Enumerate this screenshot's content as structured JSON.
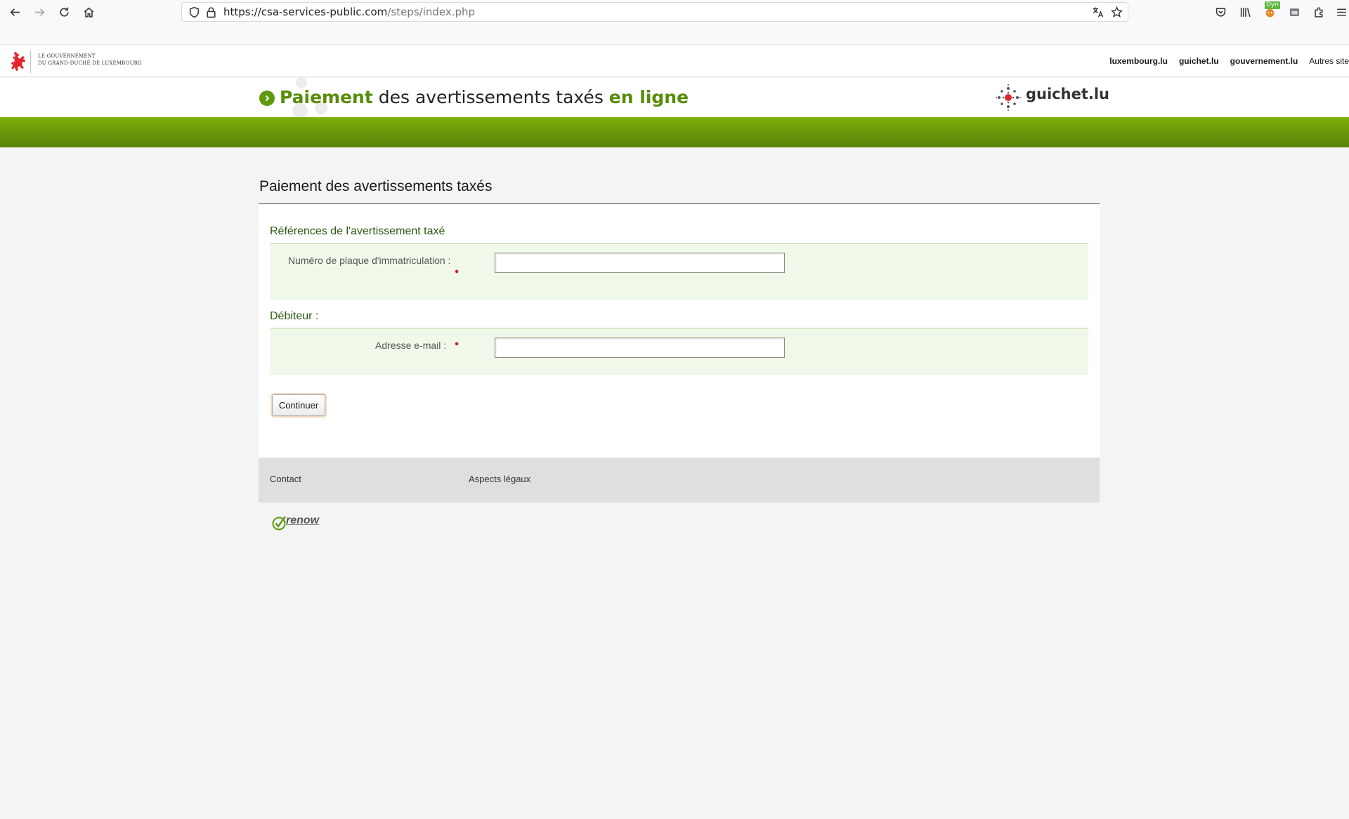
{
  "browser": {
    "url_host": "https://csa-services-public.com",
    "url_path": "/steps/index.php",
    "extension_badge": "Dyn",
    "accent": "#58b838"
  },
  "gov_bar": {
    "logo_line1": "Le Gouvernement",
    "logo_line2": "du Grand-Duché de Luxembourg",
    "links": [
      "luxembourg.lu",
      "guichet.lu",
      "gouvernement.lu",
      "Autres site"
    ]
  },
  "site_header": {
    "title_part1": "Paiement",
    "title_part2": " des avertissements taxés ",
    "title_part3": "en ligne",
    "guichet_logo": "guichet.lu",
    "brand_green": "#588c09"
  },
  "main": {
    "page_title": "Paiement des avertissements taxés",
    "section1": {
      "title": "Références de l'avertissement taxé",
      "field_label": "Numéro de plaque d'immatriculation :",
      "field_value": "",
      "required_mark": "•"
    },
    "section2": {
      "title": "Débiteur :",
      "field_label": "Adresse e-mail :",
      "field_value": "",
      "required_mark": "•"
    },
    "continue_button": "Continuer"
  },
  "footer": {
    "contact": "Contact",
    "legal": "Aspects légaux",
    "renow": "renow"
  }
}
